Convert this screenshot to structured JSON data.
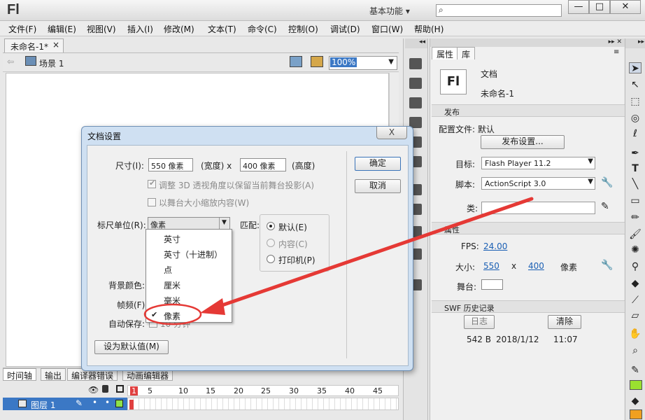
{
  "app": {
    "logo": "Fl",
    "workspace": "基本功能",
    "search_placeholder": "",
    "window_buttons": [
      "—",
      "□",
      "✕"
    ]
  },
  "menubar": [
    "文件(F)",
    "编辑(E)",
    "视图(V)",
    "插入(I)",
    "修改(M)",
    "文本(T)",
    "命令(C)",
    "控制(O)",
    "调试(D)",
    "窗口(W)",
    "帮助(H)"
  ],
  "document": {
    "tab_label": "未命名-1*",
    "tab_close": "×",
    "scene_label": "场景 1",
    "zoom": "100%"
  },
  "properties": {
    "tab_properties": "属性",
    "tab_library": "库",
    "doc_icon": "Fl",
    "doc_type": "文档",
    "doc_name": "未命名-1",
    "publish_header": "发布",
    "profile_label": "配置文件: 默认",
    "publish_settings_button": "发布设置...",
    "target_label": "目标:",
    "target_value": "Flash Player 11.2",
    "script_label": "脚本:",
    "script_value": "ActionScript 3.0",
    "class_label": "类:",
    "props_header": "属性",
    "fps_label": "FPS:",
    "fps_value": "24.00",
    "size_label": "大小:",
    "width_value": "550",
    "size_x": "x",
    "height_value": "400",
    "size_unit": "像素",
    "stage_label": "舞台:",
    "swf_header": "SWF 历史记录",
    "log_button": "日志",
    "clear_button": "清除",
    "history": {
      "size": "542 B",
      "date": "2018/1/12",
      "time": "11:07"
    }
  },
  "timeline": {
    "tabs": [
      "时间轴",
      "输出",
      "编译器错误",
      "动画编辑器"
    ],
    "frame_numbers": [
      "1",
      "5",
      "10",
      "15",
      "20",
      "25",
      "30",
      "35",
      "40",
      "45"
    ],
    "layer_name": "图层 1"
  },
  "dialog": {
    "title": "文档设置",
    "close": "X",
    "size_label": "尺寸(I):",
    "width_value": "550 像素",
    "width_label": "(宽度) x",
    "height_value": "400 像素",
    "height_label": "(高度)",
    "adjust_3d": "调整 3D 透视角度以保留当前舞台投影(A)",
    "scale_content": "以舞台大小缩放内容(W)",
    "ruler_label": "标尺单位(R):",
    "ruler_value": "像素",
    "match_label": "匹配:",
    "match_default": "默认(E)",
    "match_content": "内容(C)",
    "match_printer": "打印机(P)",
    "bg_label": "背景颜色:",
    "fps_label": "帧频(F):",
    "autosave_label": "自动保存:",
    "autosave_suffix": "10 分钟",
    "set_default_button": "设为默认值(M)",
    "ok_button": "确定",
    "cancel_button": "取消",
    "unit_options": [
      "英寸",
      "英寸（十进制）",
      "点",
      "厘米",
      "毫米",
      "像素"
    ],
    "selected_option": "像素",
    "check_mark": "✔"
  },
  "colors": {
    "annotation_red": "#e53935",
    "selection_blue": "#3b78c5",
    "tool_green": "#9ae030"
  }
}
